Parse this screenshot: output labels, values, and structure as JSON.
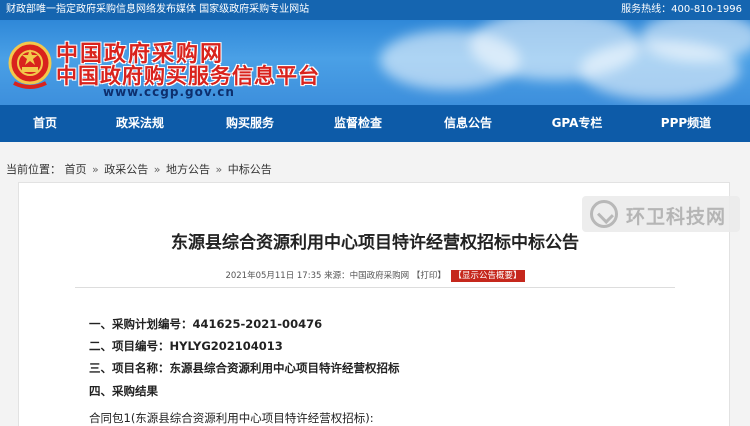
{
  "topbar": {
    "left_text": "财政部唯一指定政府采购信息网络发布媒体 国家级政府采购专业网站",
    "hotline_label": "服务热线：400-810-1996"
  },
  "banner": {
    "title": "中国政府采购网",
    "subtitle": "中国政府购买服务信息平台",
    "url": "www.ccgp.gov.cn"
  },
  "nav": {
    "items": [
      "首页",
      "政采法规",
      "购买服务",
      "监督检查",
      "信息公告",
      "GPA专栏",
      "PPP频道"
    ]
  },
  "breadcrumb": {
    "label": "当前位置：",
    "items": [
      "首页",
      "政采公告",
      "地方公告",
      "中标公告"
    ],
    "separator": "»"
  },
  "article": {
    "title": "东源县综合资源利用中心项目特许经营权招标中标公告",
    "meta_date": "2021年05月11日 17:35",
    "meta_source": "来源：中国政府采购网",
    "meta_print": "【打印】",
    "meta_badge": "【显示公告概要】",
    "lines": [
      "一、采购计划编号：441625-2021-00476",
      "二、项目编号：HYLYG202104013",
      "三、项目名称：东源县综合资源利用中心项目特许经营权招标",
      "四、采购结果",
      "合同包1(东源县综合资源利用中心项目特许经营权招标):"
    ]
  },
  "watermark": {
    "text": "环卫科技网"
  },
  "colors": {
    "topbar_bg": "#1565b0",
    "nav_bg": "#0d5ba8",
    "title_red": "#d9231d",
    "badge_red": "#c5271c"
  }
}
